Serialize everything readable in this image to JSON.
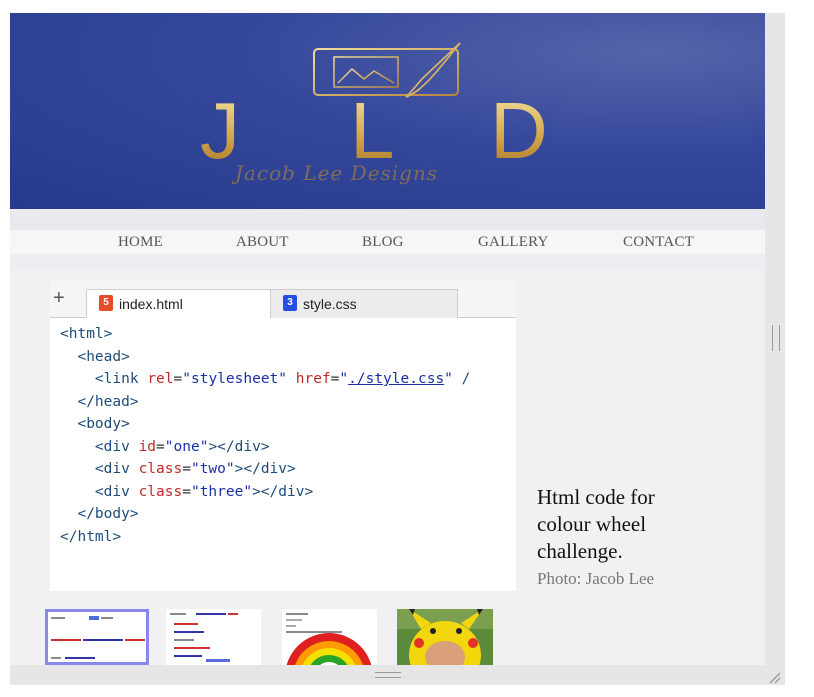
{
  "banner": {
    "logo_letters": [
      "J",
      "L",
      "D"
    ],
    "script_text": "Jacob Lee Designs"
  },
  "nav": {
    "items": [
      "HOME",
      "ABOUT",
      "BLOG",
      "GALLERY",
      "CONTACT"
    ]
  },
  "editor": {
    "add_tab": "+",
    "tabs": [
      {
        "label": "index.html",
        "icon": "html5-icon",
        "active": true
      },
      {
        "label": "style.css",
        "icon": "css3-icon",
        "active": false
      }
    ]
  },
  "caption": {
    "text": "Html code for colour wheel challenge.",
    "credit": "Photo: Jacob Lee"
  },
  "colors": {
    "banner": "#263a8c",
    "gold": "#d6a94c",
    "thumb_selected": "#8787ee"
  }
}
